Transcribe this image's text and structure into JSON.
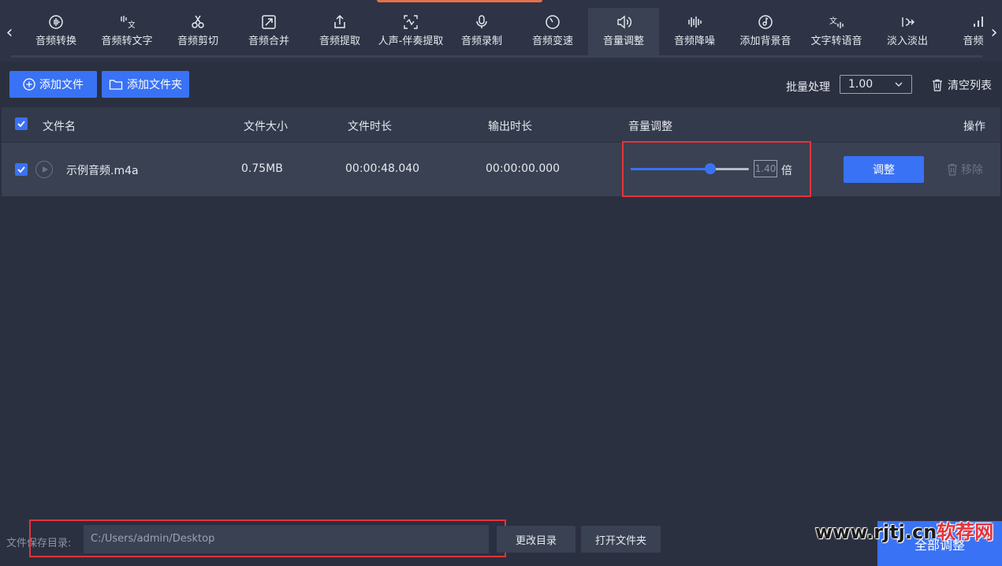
{
  "toolbar": {
    "items": [
      {
        "label": "音频转换",
        "icon": "audio-convert-icon"
      },
      {
        "label": "音频转文字",
        "icon": "speech-to-text-icon"
      },
      {
        "label": "音频剪切",
        "icon": "scissors-icon"
      },
      {
        "label": "音频合并",
        "icon": "merge-icon"
      },
      {
        "label": "音频提取",
        "icon": "extract-icon"
      },
      {
        "label": "人声-伴奏提取",
        "icon": "vocal-separation-icon"
      },
      {
        "label": "音频录制",
        "icon": "microphone-icon"
      },
      {
        "label": "音频变速",
        "icon": "speed-icon"
      },
      {
        "label": "音量调整",
        "icon": "volume-icon"
      },
      {
        "label": "音频降噪",
        "icon": "denoise-icon"
      },
      {
        "label": "添加背景音",
        "icon": "music-disc-icon"
      },
      {
        "label": "文字转语音",
        "icon": "text-to-speech-icon"
      },
      {
        "label": "淡入淡出",
        "icon": "fade-icon"
      },
      {
        "label": "音频变",
        "icon": "bars-icon"
      }
    ],
    "active_index": 8
  },
  "actions": {
    "add_file": "添加文件",
    "add_folder": "添加文件夹",
    "batch_label": "批量处理",
    "batch_value": "1.00",
    "clear_list": "清空列表"
  },
  "table": {
    "headers": {
      "name": "文件名",
      "size": "文件大小",
      "duration": "文件时长",
      "output_duration": "输出时长",
      "volume": "音量调整",
      "action": "操作"
    },
    "rows": [
      {
        "name": "示例音频.m4a",
        "size": "0.75MB",
        "duration": "00:00:48.040",
        "output_duration": "00:00:00.000",
        "volume_value": "1.40",
        "volume_unit": "倍",
        "volume_fraction": 0.67,
        "adjust": "调整",
        "remove": "移除",
        "checked": true
      }
    ]
  },
  "footer": {
    "save_label": "文件保存目录:",
    "save_path": "C:/Users/admin/Desktop",
    "change_dir": "更改目录",
    "open_folder": "打开文件夹",
    "adjust_all": "全部调整"
  },
  "watermark": {
    "prefix": "www.rjtj.cn",
    "suffix": "软荐网"
  },
  "colors": {
    "accent": "#3a72f5",
    "highlight": "#e5333a",
    "background": "#2b3040"
  }
}
